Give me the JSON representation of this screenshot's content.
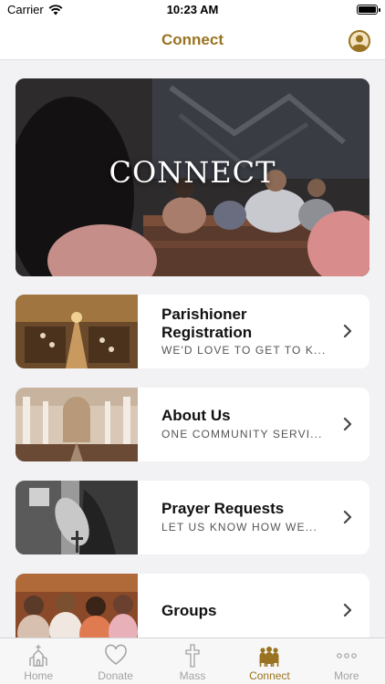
{
  "status_bar": {
    "carrier": "Carrier",
    "time": "10:23 AM"
  },
  "nav": {
    "title": "Connect",
    "profile_icon": "person-circle-icon"
  },
  "hero": {
    "title": "CONNECT"
  },
  "cards": [
    {
      "title": "Parishioner Registration",
      "subtitle": "WE'D LOVE TO GET TO K...",
      "image": "church-aisle-photo"
    },
    {
      "title": "About Us",
      "subtitle": "ONE COMMUNITY SERVI...",
      "image": "church-interior-photo"
    },
    {
      "title": "Prayer Requests",
      "subtitle": "LET US KNOW HOW WE...",
      "image": "praying-hands-photo"
    },
    {
      "title": "Groups",
      "subtitle": "",
      "image": "group-of-women-photo"
    }
  ],
  "tabs": [
    {
      "label": "Home",
      "icon": "church-icon",
      "active": false
    },
    {
      "label": "Donate",
      "icon": "heart-icon",
      "active": false
    },
    {
      "label": "Mass",
      "icon": "cross-icon",
      "active": false
    },
    {
      "label": "Connect",
      "icon": "people-icon",
      "active": true
    },
    {
      "label": "More",
      "icon": "ellipsis-icon",
      "active": false
    }
  ],
  "colors": {
    "accent": "#9a7322",
    "inactive": "#a3a3a3",
    "background": "#f2f2f4"
  }
}
